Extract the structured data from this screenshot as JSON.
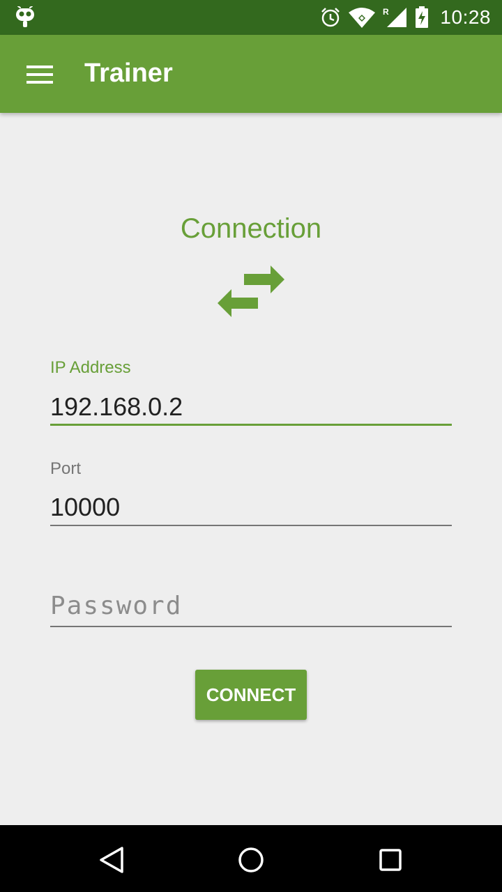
{
  "status_bar": {
    "time": "10:28",
    "icons": [
      "cyanogenmod-bot-icon",
      "alarm-icon",
      "wifi-icon",
      "cellular-roaming-icon",
      "battery-charging-icon"
    ]
  },
  "app_bar": {
    "title": "Trainer",
    "menu_icon": "hamburger-menu-icon"
  },
  "section": {
    "title": "Connection",
    "icon": "swap-arrows-icon"
  },
  "form": {
    "ip_address": {
      "label": "IP Address",
      "value": "192.168.0.2",
      "focused": true
    },
    "port": {
      "label": "Port",
      "value": "10000"
    },
    "password": {
      "placeholder": "Password",
      "value": ""
    },
    "connect_label": "CONNECT"
  },
  "nav_bar": {
    "icons": [
      "back-icon",
      "home-icon",
      "recents-icon"
    ]
  },
  "colors": {
    "status_bar": "#33691e",
    "primary": "#689f38",
    "background": "#eeeeee",
    "nav_bar": "#000000"
  }
}
